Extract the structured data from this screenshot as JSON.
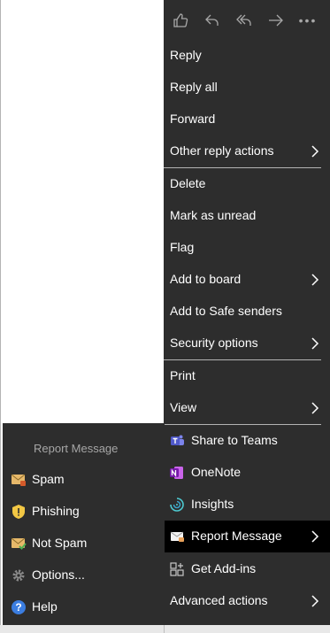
{
  "colors": {
    "menu_bg": "#2d2d2d",
    "selected_bg": "#000000",
    "text": "#ffffff",
    "muted_text": "#a6a6a6",
    "separator": "#b3b3b3"
  },
  "toolbar": {
    "icons": [
      "like-icon",
      "reply-icon",
      "reply-all-icon",
      "forward-icon",
      "more-options-icon"
    ]
  },
  "menu": {
    "reply": "Reply",
    "reply_all": "Reply all",
    "forward": "Forward",
    "other_reply_actions": "Other reply actions",
    "delete": "Delete",
    "mark_as_unread": "Mark as unread",
    "flag": "Flag",
    "add_to_board": "Add to board",
    "add_to_safe_senders": "Add to Safe senders",
    "security_options": "Security options",
    "print": "Print",
    "view": "View",
    "share_to_teams": "Share to Teams",
    "onenote": "OneNote",
    "insights": "Insights",
    "report_message": "Report Message",
    "get_add_ins": "Get Add-ins",
    "advanced_actions": "Advanced actions"
  },
  "submenu": {
    "title": "Report Message",
    "items": [
      "Spam",
      "Phishing",
      "Not Spam",
      "Options...",
      "Help"
    ],
    "icons": [
      "spam-envelope-icon",
      "phishing-shield-icon",
      "not-spam-envelope-icon",
      "options-gear-icon",
      "help-icon"
    ]
  }
}
